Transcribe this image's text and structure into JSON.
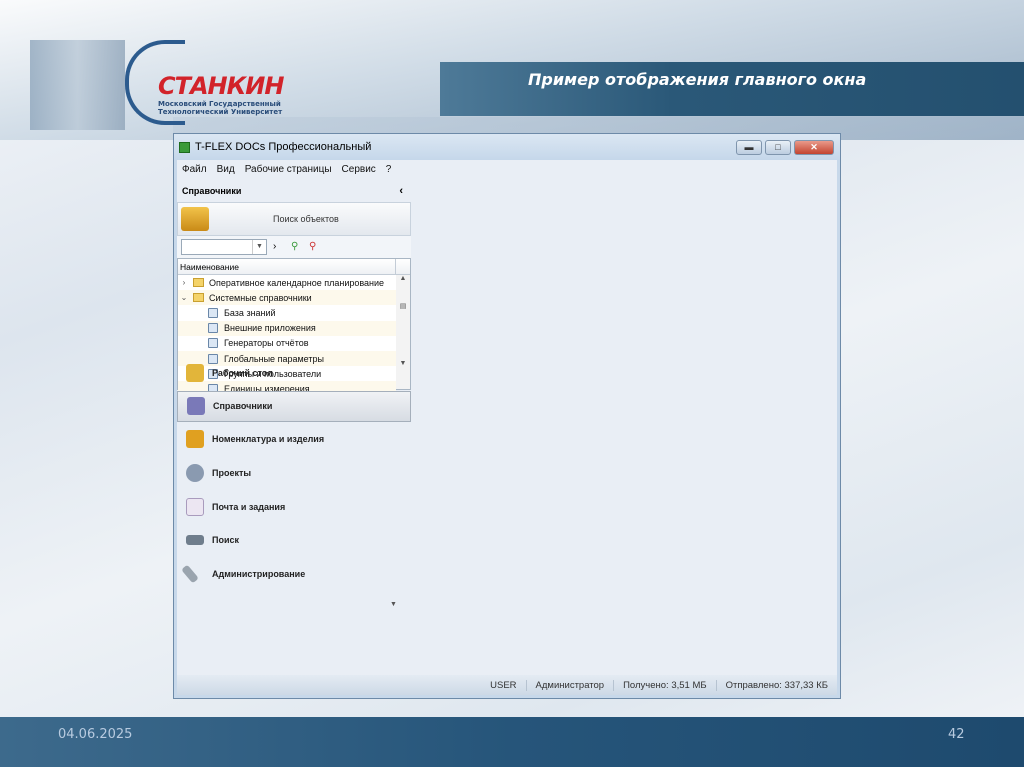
{
  "slide": {
    "title": "Пример отображения главного окна",
    "date": "04.06.2025",
    "page_number": "42",
    "logo": {
      "name": "СТАНКИН",
      "subtitle_line1": "Московский Государственный",
      "subtitle_line2": "Технологический Университет"
    }
  },
  "window": {
    "title": "T-FLEX DOCs Профессиональный",
    "controls": {
      "minimize": "▬",
      "maximize": "□",
      "close": "✕"
    },
    "menu": [
      "Файл",
      "Вид",
      "Рабочие страницы",
      "Сервис",
      "?"
    ],
    "panel": {
      "header": "Справочники",
      "collapse": "‹",
      "search_button": "Поиск объектов",
      "column_header": "Наименование",
      "tree": [
        {
          "label": "Оперативное календарное планирование",
          "level": 0,
          "expander": "›",
          "icon": "folder-icon"
        },
        {
          "label": "Системные справочники",
          "level": 0,
          "expander": "⌄",
          "icon": "folder-icon"
        },
        {
          "label": "База знаний",
          "level": 1,
          "icon": "knowledge-base-icon"
        },
        {
          "label": "Внешние приложения",
          "level": 1,
          "icon": "external-apps-icon"
        },
        {
          "label": "Генераторы отчётов",
          "level": 1,
          "icon": "report-generator-icon"
        },
        {
          "label": "Глобальные параметры",
          "level": 1,
          "icon": "global-params-icon"
        },
        {
          "label": "Группы и пользователи",
          "level": 1,
          "icon": "users-icon"
        },
        {
          "label": "Единицы измерения",
          "level": 1,
          "icon": "units-icon"
        }
      ]
    },
    "nav": [
      {
        "label": "Рабочий стол",
        "icon": "desktop-icon",
        "color": "#e2b53a"
      },
      {
        "label": "Справочники",
        "icon": "database-icon",
        "color": "#7a79b8",
        "selected": true
      },
      {
        "label": "Номенклатура и изделия",
        "icon": "box-icon",
        "color": "#e0a020"
      },
      {
        "label": "Проекты",
        "icon": "gears-icon",
        "color": "#8a9ab0"
      },
      {
        "label": "Почта и задания",
        "icon": "mail-icon",
        "color": "#c9b8d8"
      },
      {
        "label": "Поиск",
        "icon": "binoculars-icon",
        "color": "#6f7d8c"
      },
      {
        "label": "Администрирование",
        "icon": "wrench-icon",
        "color": "#9aa4ae"
      }
    ],
    "status": [
      "USER",
      "Администратор",
      "Получено: 3,51 МБ",
      "Отправлено: 337,33 КБ"
    ]
  }
}
